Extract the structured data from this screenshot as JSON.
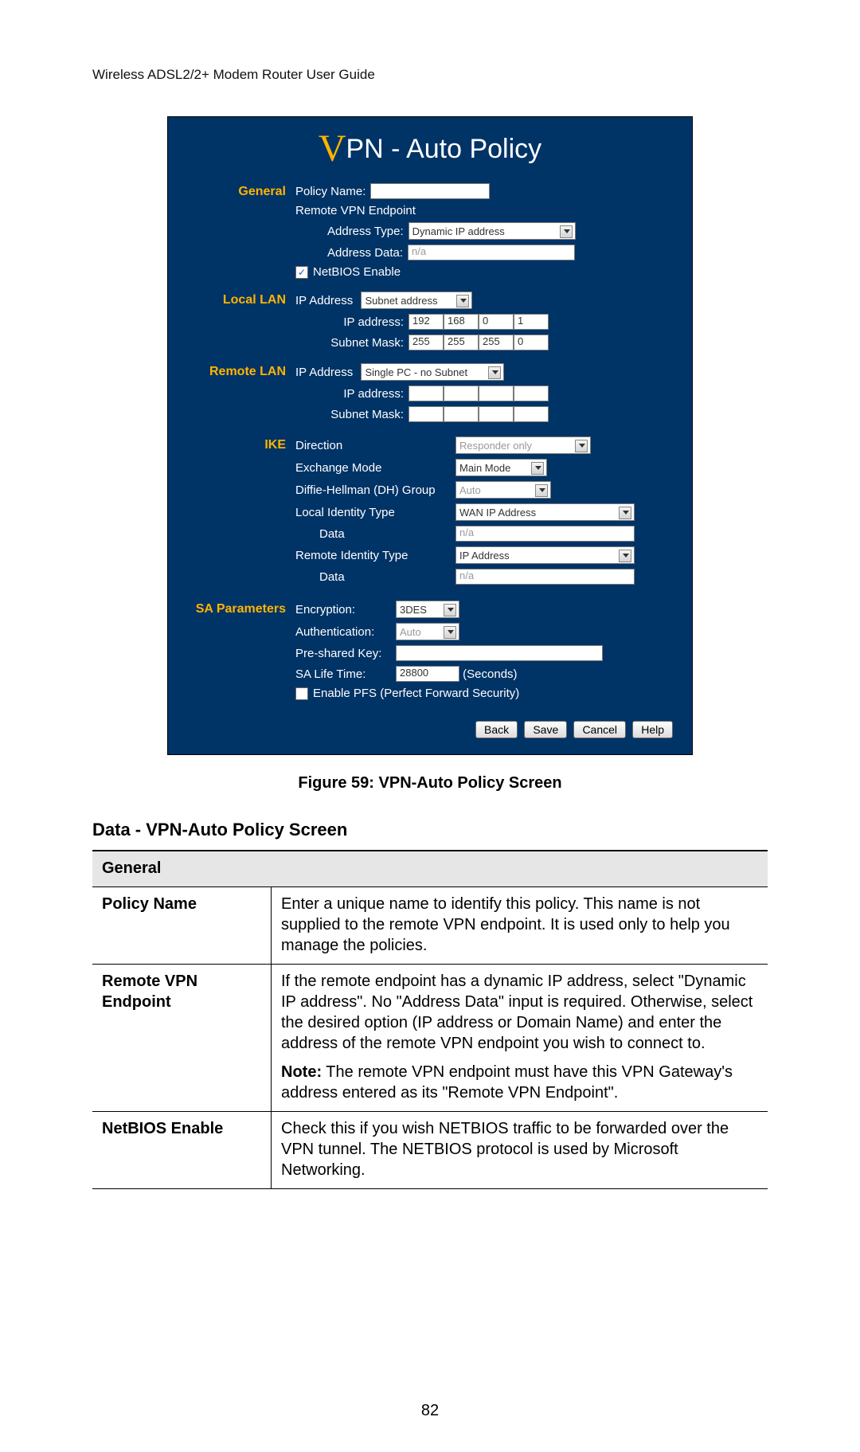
{
  "doc_header": "Wireless ADSL2/2+ Modem Router User Guide",
  "page_number": "82",
  "caption": "Figure 59: VPN-Auto Policy Screen",
  "section_heading": "Data - VPN-Auto Policy Screen",
  "screenshot": {
    "title_prefix": "V",
    "title_rest": "PN - Auto Policy",
    "sections": {
      "general": {
        "label": "General",
        "policy_name_label": "Policy Name:",
        "policy_name_value": "",
        "remote_vpn_endpoint_label": "Remote VPN Endpoint",
        "address_type_label": "Address Type:",
        "address_type_value": "Dynamic IP address",
        "address_data_label": "Address Data:",
        "address_data_value": "n/a",
        "netbios_checked": true,
        "netbios_label": "NetBIOS Enable"
      },
      "local_lan": {
        "label": "Local LAN",
        "ip_address_label": "IP Address",
        "ip_address_type": "Subnet address",
        "ip_addr_lbl": "IP address:",
        "ip_addr": [
          "192",
          "168",
          "0",
          "1"
        ],
        "subnet_mask_lbl": "Subnet Mask:",
        "subnet_mask": [
          "255",
          "255",
          "255",
          "0"
        ]
      },
      "remote_lan": {
        "label": "Remote LAN",
        "ip_address_label": "IP Address",
        "ip_address_type": "Single PC - no Subnet",
        "ip_addr_lbl": "IP address:",
        "ip_addr": [
          "",
          "",
          "",
          ""
        ],
        "subnet_mask_lbl": "Subnet Mask:",
        "subnet_mask": [
          "",
          "",
          "",
          ""
        ]
      },
      "ike": {
        "label": "IKE",
        "direction_lbl": "Direction",
        "direction_val": "Responder only",
        "exchange_lbl": "Exchange Mode",
        "exchange_val": "Main Mode",
        "dh_lbl": "Diffie-Hellman (DH) Group",
        "dh_val": "Auto",
        "local_id_type_lbl": "Local Identity Type",
        "local_id_type_val": "WAN IP Address",
        "local_id_data_lbl": "Data",
        "local_id_data_val": "n/a",
        "remote_id_type_lbl": "Remote Identity Type",
        "remote_id_type_val": "IP Address",
        "remote_id_data_lbl": "Data",
        "remote_id_data_val": "n/a"
      },
      "sa": {
        "label": "SA Parameters",
        "encryption_lbl": "Encryption:",
        "encryption_val": "3DES",
        "auth_lbl": "Authentication:",
        "auth_val": "Auto",
        "psk_lbl": "Pre-shared Key:",
        "psk_val": "",
        "life_lbl": "SA Life Time:",
        "life_val": "28800",
        "life_unit": "(Seconds)",
        "pfs_checked": false,
        "pfs_label": "Enable PFS (Perfect Forward Security)"
      }
    },
    "buttons": {
      "back": "Back",
      "save": "Save",
      "cancel": "Cancel",
      "help": "Help"
    }
  },
  "table": {
    "header": "General",
    "rows": [
      {
        "term": "Policy Name",
        "paras": [
          "Enter a unique name to identify this policy. This name is not supplied to the remote VPN endpoint. It is used only to help you manage the policies."
        ]
      },
      {
        "term": "Remote VPN Endpoint",
        "paras": [
          "If the remote endpoint has a dynamic IP address, select \"Dynamic IP address\". No \"Address Data\" input is required. Otherwise, select the desired option (IP address or Domain Name) and enter the address of the remote VPN endpoint you wish to connect to.",
          "<b>Note:</b> The remote VPN endpoint must have this VPN Gateway's address entered as its \"Remote VPN Endpoint\"."
        ]
      },
      {
        "term": "NetBIOS Enable",
        "paras": [
          "Check this if you wish NETBIOS traffic to be forwarded over the VPN tunnel. The NETBIOS protocol is used by Microsoft Networking."
        ]
      }
    ]
  }
}
